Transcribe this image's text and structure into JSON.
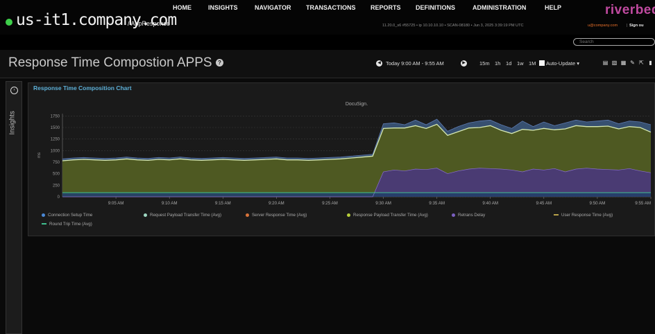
{
  "header": {
    "hostname": "us-it1.company.com",
    "app_path": "/ AppResponse",
    "sysinfo": "11.20.0_s6 #55725 • ip 10.10.10.10 • SCAN-08180 • Jun 3, 2025 3:39:19 PM UTC",
    "user": "u@company.com",
    "separator": "|",
    "sign_out": "Sign ou",
    "brand": "riverbed",
    "status_color": "#3ecf4a"
  },
  "nav": {
    "items": [
      "HOME",
      "INSIGHTS",
      "NAVIGATOR",
      "TRANSACTIONS",
      "REPORTS",
      "DEFINITIONS",
      "ADMINISTRATION",
      "HELP"
    ],
    "search_placeholder": "Search"
  },
  "page": {
    "title": "Response Time Compostion APPS",
    "help_icon": "question-circle-icon",
    "time_range": "Today 9:00 AM - 9:55 AM",
    "range_options": [
      "15m",
      "1h",
      "1d",
      "1w",
      "1M"
    ],
    "auto_update_label": "Auto-Update ▾",
    "tool_icons": [
      "save-icon",
      "pdf-icon",
      "print-icon",
      "wrench-icon",
      "external-link-icon"
    ]
  },
  "sidebar": {
    "label": "Insights"
  },
  "panel": {
    "title": "Response Time Composition Chart"
  },
  "chart_data": {
    "type": "area",
    "title": "DocuSign.",
    "ylabel": "ms",
    "ylim": [
      0,
      1800
    ],
    "yticks": [
      0,
      250,
      500,
      750,
      1000,
      1250,
      1500,
      1750
    ],
    "x_labels": [
      "9:05 AM",
      "9:10 AM",
      "9:15 AM",
      "9:20 AM",
      "9:25 AM",
      "9:30 AM",
      "9:35 AM",
      "9:40 AM",
      "9:45 AM",
      "9:50 AM",
      "9:55 AM"
    ],
    "x": [
      "9:00",
      "9:01",
      "9:02",
      "9:03",
      "9:04",
      "9:05",
      "9:06",
      "9:07",
      "9:08",
      "9:09",
      "9:10",
      "9:11",
      "9:12",
      "9:13",
      "9:14",
      "9:15",
      "9:16",
      "9:17",
      "9:18",
      "9:19",
      "9:20",
      "9:21",
      "9:22",
      "9:23",
      "9:24",
      "9:25",
      "9:26",
      "9:27",
      "9:28",
      "9:29",
      "9:30",
      "9:31",
      "9:32",
      "9:33",
      "9:34",
      "9:35",
      "9:36",
      "9:37",
      "9:38",
      "9:39",
      "9:40",
      "9:41",
      "9:42",
      "9:43",
      "9:44",
      "9:45",
      "9:46",
      "9:47",
      "9:48",
      "9:49",
      "9:50",
      "9:51",
      "9:52",
      "9:53",
      "9:54",
      "9:55"
    ],
    "grid": true,
    "legend_position": "bottom",
    "series": [
      {
        "name": "Connection Setup Time",
        "color": "#4a88d6",
        "marker": "dot",
        "values": [
          80,
          80,
          80,
          80,
          80,
          80,
          80,
          80,
          80,
          80,
          80,
          80,
          80,
          80,
          80,
          80,
          80,
          80,
          80,
          80,
          80,
          80,
          80,
          80,
          80,
          80,
          80,
          80,
          80,
          80,
          80,
          80,
          80,
          80,
          80,
          80,
          80,
          80,
          80,
          80,
          80,
          80,
          80,
          80,
          80,
          80,
          80,
          80,
          80,
          80,
          80,
          80,
          80,
          80,
          80,
          80
        ]
      },
      {
        "name": "Request Payload Transfer Time (Avg)",
        "color": "#9ed7c2",
        "marker": "dot",
        "values": [
          10,
          10,
          10,
          10,
          10,
          10,
          10,
          10,
          10,
          10,
          10,
          10,
          10,
          10,
          10,
          10,
          10,
          10,
          10,
          10,
          10,
          10,
          10,
          10,
          10,
          10,
          10,
          10,
          10,
          10,
          10,
          10,
          10,
          10,
          10,
          10,
          10,
          10,
          10,
          10,
          10,
          10,
          10,
          10,
          10,
          10,
          10,
          10,
          10,
          10,
          10,
          10,
          10,
          10,
          10,
          10
        ]
      },
      {
        "name": "Server Response Time (Avg)",
        "color": "#d9733a",
        "marker": "dot",
        "values": [
          5,
          5,
          5,
          5,
          5,
          5,
          5,
          5,
          5,
          5,
          5,
          5,
          5,
          5,
          5,
          5,
          5,
          5,
          5,
          5,
          5,
          5,
          5,
          5,
          5,
          5,
          5,
          5,
          5,
          5,
          5,
          5,
          5,
          5,
          5,
          5,
          5,
          5,
          5,
          5,
          5,
          5,
          5,
          5,
          5,
          5,
          5,
          5,
          5,
          5,
          5,
          5,
          5,
          5,
          5,
          5
        ]
      },
      {
        "name": "Response Payload Transfer Time (Avg)",
        "color": "#b7cf3a",
        "marker": "dot",
        "values": [
          680,
          700,
          710,
          700,
          690,
          700,
          720,
          700,
          690,
          710,
          700,
          720,
          700,
          690,
          700,
          710,
          700,
          690,
          700,
          710,
          720,
          700,
          700,
          690,
          700,
          710,
          720,
          740,
          760,
          780,
          840,
          820,
          830,
          840,
          810,
          850,
          700,
          760,
          800,
          780,
          790,
          760,
          690,
          820,
          760,
          790,
          750,
          820,
          840,
          800,
          820,
          830,
          780,
          820,
          850,
          780
        ]
      },
      {
        "name": "Retrans Delay",
        "color": "#7a5fc0",
        "marker": "dot",
        "values": [
          0,
          0,
          0,
          0,
          0,
          0,
          0,
          0,
          0,
          0,
          0,
          0,
          0,
          0,
          0,
          0,
          0,
          0,
          0,
          0,
          0,
          0,
          0,
          0,
          0,
          0,
          0,
          0,
          0,
          0,
          540,
          580,
          560,
          600,
          590,
          620,
          500,
          560,
          600,
          620,
          610,
          600,
          580,
          540,
          600,
          580,
          610,
          540,
          600,
          620,
          600,
          590,
          580,
          610,
          560,
          520
        ]
      },
      {
        "name": "User Response Time (Avg)",
        "color": "#b8a24a",
        "marker": "line",
        "values": [
          780,
          800,
          810,
          800,
          790,
          800,
          820,
          800,
          790,
          810,
          800,
          820,
          800,
          790,
          800,
          810,
          800,
          790,
          800,
          810,
          820,
          800,
          800,
          790,
          800,
          810,
          820,
          840,
          860,
          880,
          1480,
          1490,
          1490,
          1540,
          1480,
          1570,
          1330,
          1410,
          1490,
          1500,
          1540,
          1440,
          1370,
          1460,
          1440,
          1480,
          1450,
          1470,
          1540,
          1520,
          1520,
          1530,
          1470,
          1520,
          1500,
          1400
        ]
      },
      {
        "name": "Round Trip Time (Avg)",
        "color": "#3fbf8f",
        "marker": "line",
        "values": [
          90,
          90,
          90,
          90,
          90,
          90,
          90,
          90,
          90,
          90,
          90,
          90,
          90,
          90,
          90,
          90,
          90,
          90,
          90,
          90,
          90,
          90,
          90,
          90,
          90,
          90,
          90,
          90,
          90,
          90,
          90,
          90,
          90,
          90,
          90,
          90,
          90,
          90,
          90,
          90,
          90,
          90,
          90,
          90,
          90,
          90,
          90,
          90,
          90,
          90,
          90,
          90,
          90,
          90,
          90,
          90
        ]
      }
    ],
    "upper_band": {
      "name": "",
      "color": "#3d5a80",
      "values": [
        820,
        840,
        850,
        840,
        830,
        840,
        860,
        840,
        830,
        850,
        840,
        860,
        840,
        830,
        840,
        850,
        840,
        830,
        840,
        850,
        860,
        840,
        840,
        830,
        840,
        850,
        860,
        880,
        900,
        920,
        1580,
        1600,
        1560,
        1660,
        1560,
        1680,
        1420,
        1520,
        1600,
        1640,
        1660,
        1560,
        1480,
        1640,
        1520,
        1620,
        1540,
        1600,
        1660,
        1620,
        1640,
        1660,
        1580,
        1640,
        1620,
        1560
      ]
    }
  }
}
